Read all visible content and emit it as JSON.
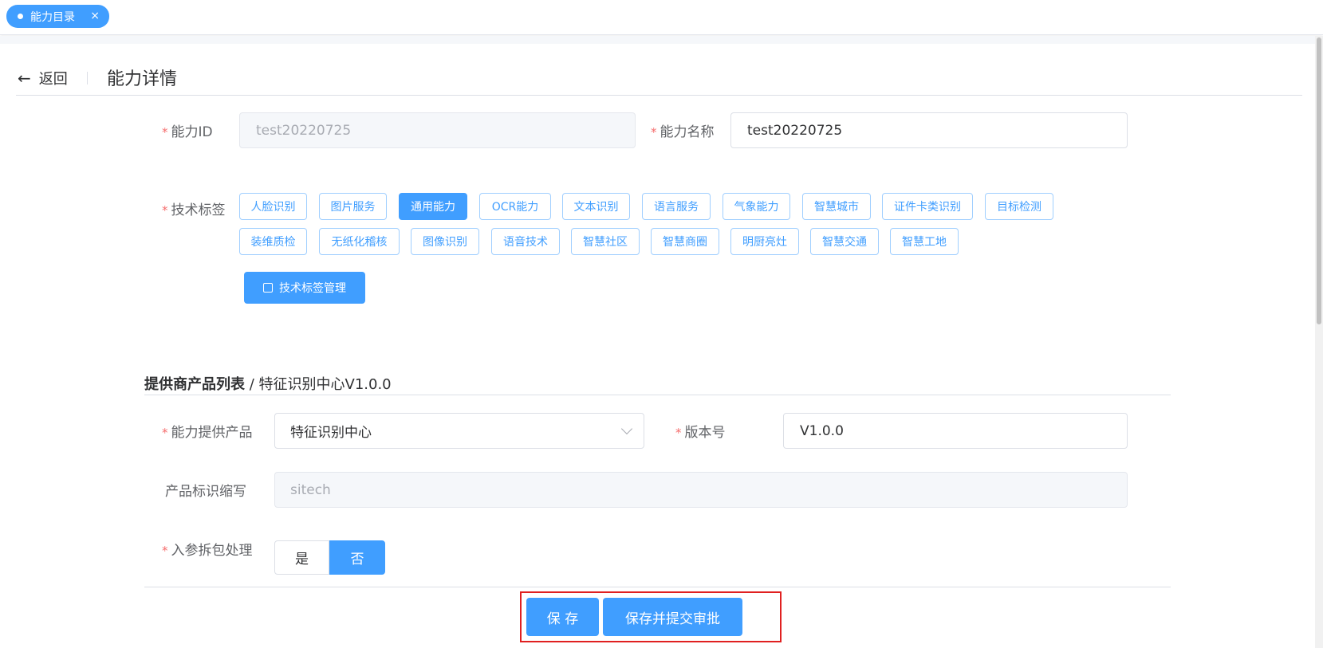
{
  "tabbar": {
    "tab_label": "能力目录",
    "tab_close": "×"
  },
  "header": {
    "back_label": "返回",
    "title": "能力详情"
  },
  "form": {
    "ability_id": {
      "label": "能力ID",
      "value": "test20220725"
    },
    "ability_name": {
      "label": "能力名称",
      "value": "test20220725"
    },
    "tech_tags": {
      "label": "技术标签",
      "row1": [
        "人脸识别",
        "图片服务",
        "通用能力",
        "OCR能力",
        "文本识别",
        "语言服务",
        "气象能力",
        "智慧城市",
        "证件卡类识别",
        "目标检测"
      ],
      "row2": [
        "装维质检",
        "无纸化稽核",
        "图像识别",
        "语音技术",
        "智慧社区",
        "智慧商圈",
        "明厨亮灶",
        "智慧交通",
        "智慧工地"
      ],
      "active": "通用能力",
      "manage_button": "技术标签管理"
    }
  },
  "provider": {
    "section_title_bold": "提供商产品列表",
    "section_title_rest": " / 特征识别中心V1.0.0",
    "product": {
      "label": "能力提供产品",
      "value": "特征识别中心"
    },
    "version": {
      "label": "版本号",
      "value": "V1.0.0"
    },
    "abbr": {
      "label": "产品标识缩写",
      "value": "sitech"
    },
    "unpack": {
      "label": "入参拆包处理",
      "options": [
        "是",
        "否"
      ],
      "selected": "否"
    }
  },
  "actions": {
    "save": "保 存",
    "save_submit": "保存并提交审批"
  },
  "colors": {
    "primary": "#409eff",
    "required": "#f56c6c",
    "highlight": "#e02020"
  }
}
